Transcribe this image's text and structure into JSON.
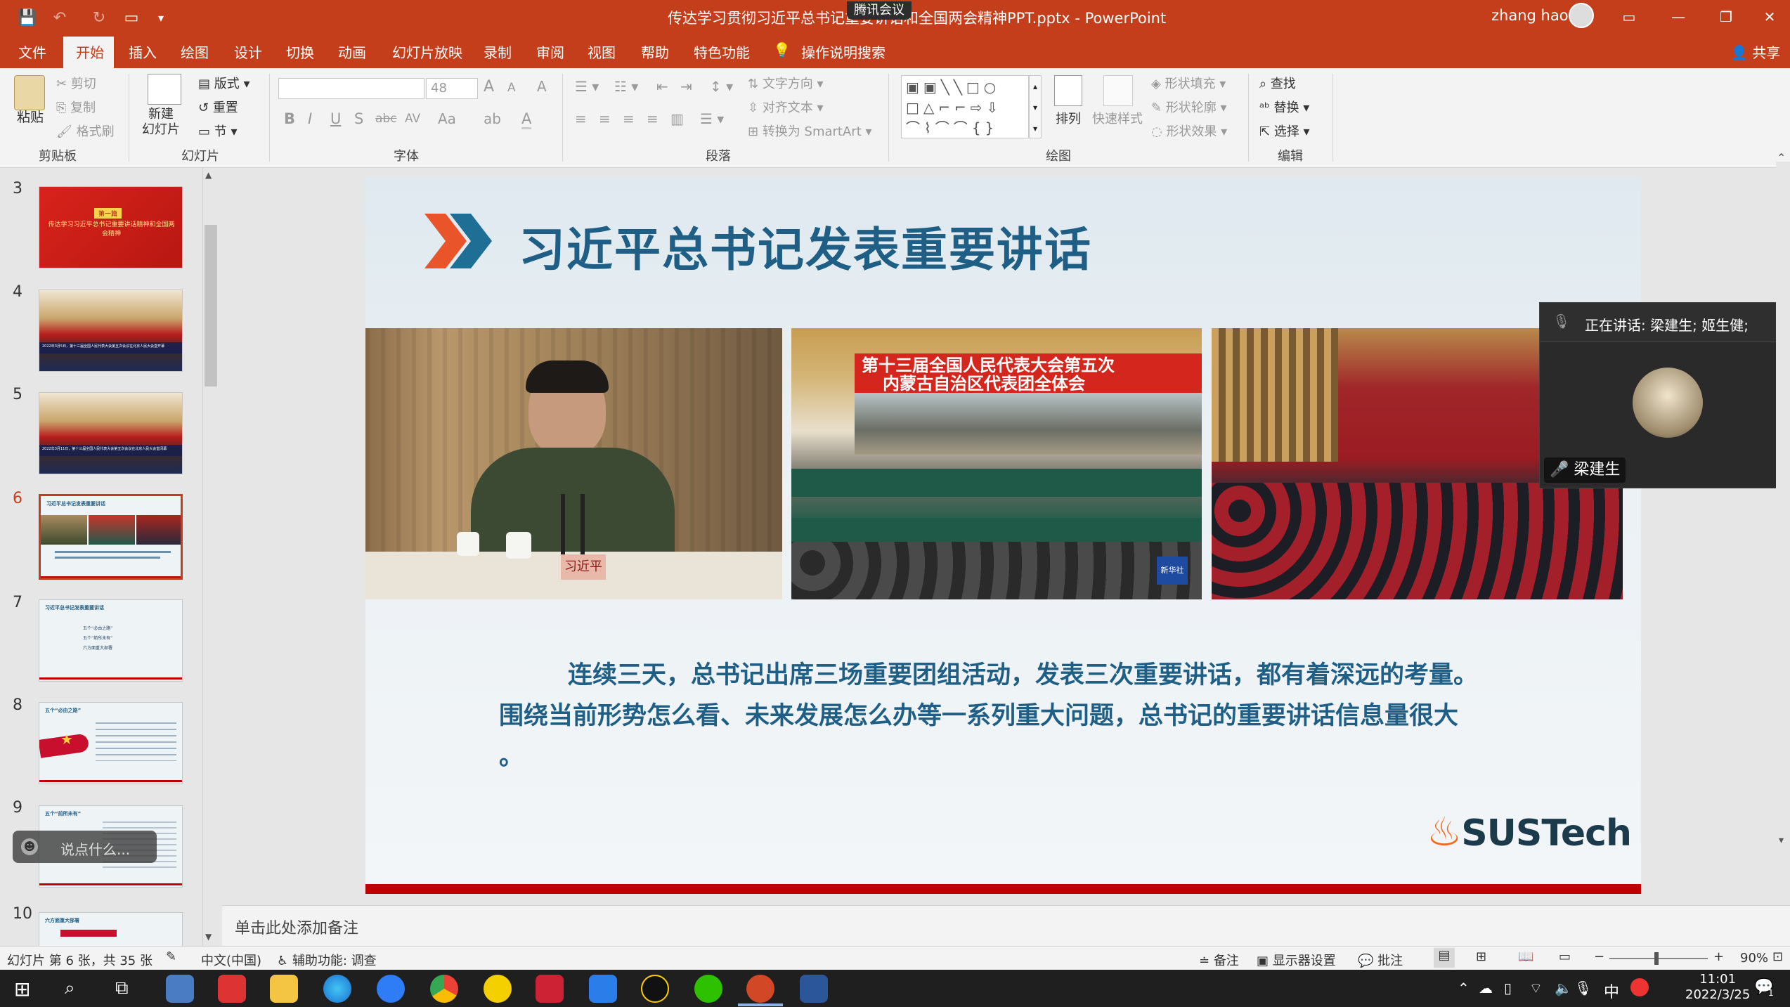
{
  "titlebar": {
    "title": "传达学习贯彻习近平总书记重要讲话和全国两会精神PPT.pptx  -  PowerPoint",
    "meeting_label": "腾讯会议",
    "user_name": "zhang hao",
    "controls": {
      "ribbon_display": "▭",
      "minimize": "—",
      "restore": "❐",
      "close": "✕"
    },
    "qat": {
      "save": "💾",
      "undo": "↶",
      "redo": "↻",
      "present": "▭",
      "more": "▾"
    }
  },
  "menu": {
    "items": [
      "文件",
      "开始",
      "插入",
      "绘图",
      "设计",
      "切换",
      "动画",
      "幻灯片放映",
      "录制",
      "审阅",
      "视图",
      "帮助",
      "特色功能"
    ],
    "active": "开始",
    "tell_me": "操作说明搜索",
    "share": "共享"
  },
  "ribbon": {
    "clipboard": {
      "label": "剪贴板",
      "paste": "粘贴",
      "cut": "剪切",
      "copy": "复制",
      "format_painter": "格式刷"
    },
    "slides": {
      "label": "幻灯片",
      "new_slide": "新建\n幻灯片",
      "layout": "版式",
      "reset": "重置",
      "section": "节"
    },
    "font": {
      "label": "字体",
      "font_name": "",
      "font_size": "48",
      "bold": "B",
      "italic": "I",
      "underline": "U",
      "shadow": "S",
      "strike": "abc",
      "spacing": "AV",
      "case": "Aa",
      "clear": "A",
      "grow": "A",
      "shrink": "A",
      "color": "A"
    },
    "paragraph": {
      "label": "段落",
      "text_direction": "文字方向",
      "align_text": "对齐文本",
      "smartart": "转换为 SmartArt"
    },
    "drawing": {
      "label": "绘图",
      "arrange": "排列",
      "quick_styles": "快速样式",
      "fill": "形状填充",
      "outline": "形状轮廓",
      "effects": "形状效果"
    },
    "editing": {
      "label": "编辑",
      "find": "查找",
      "replace": "替换",
      "select": "选择"
    }
  },
  "thumbnails": [
    {
      "num": "3",
      "title": "传达学习习近平总书记重要讲话精神和全国两会精神",
      "tag": "第一篇"
    },
    {
      "num": "4",
      "caption": "2022年3月5日，第十三届全国人民代表大会第五次会议在北京人民大会堂开幕"
    },
    {
      "num": "5",
      "caption": "2022年3月11日，第十三届全国人民代表大会第五次会议在北京人民大会堂闭幕"
    },
    {
      "num": "6",
      "title": "习近平总书记发表重要讲话",
      "selected": true
    },
    {
      "num": "7",
      "title": "习近平总书记发表重要讲话",
      "items": [
        "五个“必由之路”",
        "五个“前所未有”",
        "六方面重大部署"
      ]
    },
    {
      "num": "8",
      "title": "五个“必由之路”"
    },
    {
      "num": "9",
      "title": "五个“前所未有”"
    },
    {
      "num": "10",
      "title": "六方面重大部署"
    }
  ],
  "slide": {
    "title": "习近平总书记发表重要讲话",
    "photo1_nameplate": "习近平",
    "photo2_banner_line1": "第十三届全国人民代表大会第五次",
    "photo2_banner_line2": "内蒙古自治区代表团全体会",
    "photo2_watermark": "新华社",
    "body_line1": "连续三天，总书记出席三场重要团组活动，发表三次重要讲话，都有着深远的考量。",
    "body_line2": "围绕当前形势怎么看、未来发展怎么办等一系列重大问题，总书记的重要讲话信息量很大",
    "body_line3": "。",
    "logo_text": "SUSTech"
  },
  "notes": {
    "placeholder": "单击此处添加备注"
  },
  "float_input": {
    "placeholder": "说点什么..."
  },
  "meeting": {
    "speaking": "正在讲话: 梁建生; 姬生健;",
    "participant": "梁建生"
  },
  "status": {
    "slide_info": "幻灯片 第 6 张，共 35 张",
    "language": "中文(中国)",
    "accessibility": "辅助功能: 调查",
    "notes_btn": "备注",
    "display_settings": "显示器设置",
    "comments": "批注",
    "zoom": "90%"
  },
  "taskbar": {
    "time": "11:01",
    "date": "2022/3/25",
    "ime": "中",
    "notif": "1"
  },
  "colors": {
    "accent": "#c43e1c",
    "slide_title": "#1f5f86",
    "slide_bar": "#c00000"
  }
}
